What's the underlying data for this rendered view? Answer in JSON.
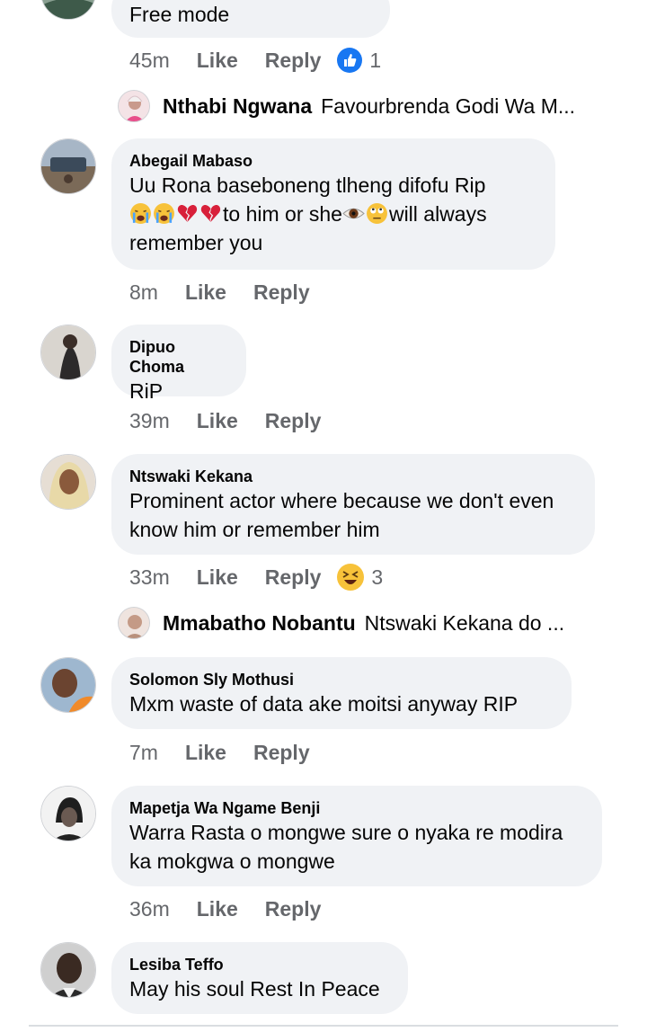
{
  "partial_comment": {
    "text": "Free mode",
    "time": "45m",
    "like": "Like",
    "reply": "Reply",
    "reaction_count": "1",
    "reaction": "like-icon"
  },
  "reply_preview_1": {
    "name": "Nthabi Ngwana",
    "text": "Favourbrenda Godi Wa M..."
  },
  "comments": [
    {
      "author": "Abegail Mabaso",
      "line1": "Uu Rona baseboneng tlheng difofu Rip",
      "line2_text_a": "to him or she",
      "line2_text_b": "will always",
      "line3": "remember you",
      "time": "8m",
      "like": "Like",
      "reply": "Reply"
    },
    {
      "author": "Dipuo Choma",
      "text": "RiP",
      "time": "39m",
      "like": "Like",
      "reply": "Reply"
    },
    {
      "author": "Ntswaki Kekana",
      "line1": "Prominent actor where because we don't even",
      "line2": "know him or remember him",
      "time": "33m",
      "like": "Like",
      "reply": "Reply",
      "reaction_count": "3",
      "reaction": "haha-icon"
    },
    {
      "author": "Solomon Sly Mothusi",
      "text": "Mxm waste of data ake moitsi  anyway RIP",
      "time": "7m",
      "like": "Like",
      "reply": "Reply"
    },
    {
      "author": "Mapetja Wa Ngame Benji",
      "line1": "Warra Rasta o mongwe sure o nyaka re modira",
      "line2": "ka mokgwa o mongwe",
      "time": "36m",
      "like": "Like",
      "reply": "Reply"
    },
    {
      "author": "Lesiba Teffo",
      "text": "May his soul Rest In Peace"
    }
  ],
  "reply_preview_2": {
    "name": "Mmabatho Nobantu",
    "text": "Ntswaki Kekana do ..."
  },
  "colors": {
    "bubble": "#f0f2f5",
    "meta": "#65676b",
    "like_blue": "#1877f2",
    "haha_yellow": "#f7c23a"
  }
}
